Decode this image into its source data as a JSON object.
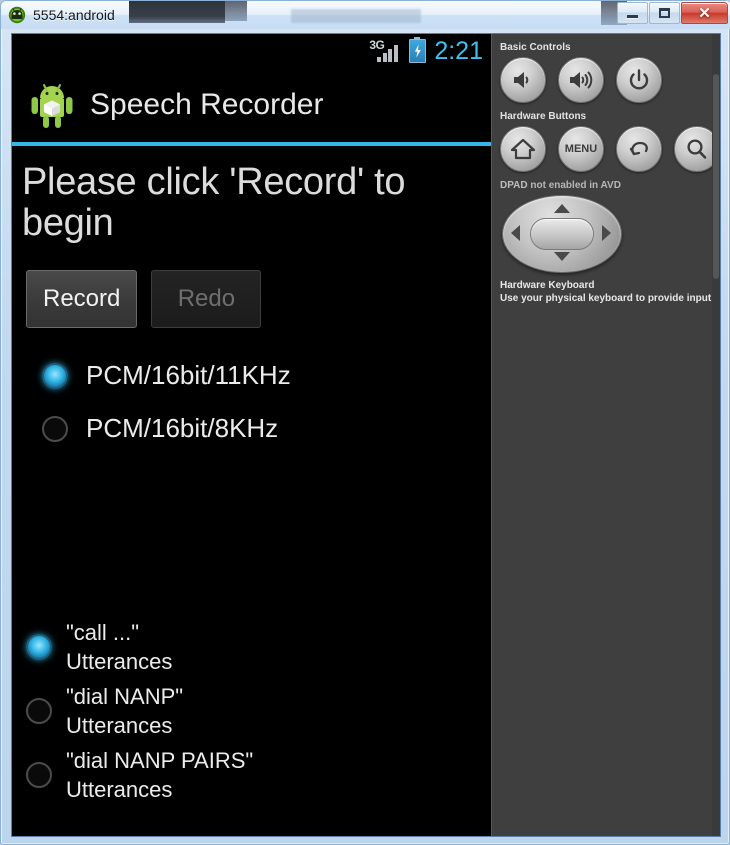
{
  "window": {
    "title": "5554:android",
    "icon": "android-head-icon",
    "buttons": {
      "minimize": "minimize-button",
      "maximize": "maximize-button",
      "close_label": "✕"
    }
  },
  "device": {
    "status_bar": {
      "network_type": "3G",
      "signal_bars": 4,
      "battery_state": "charging",
      "clock": "2:21",
      "clock_color": "#3fc0ef"
    },
    "app_bar": {
      "icon": "android-robot-icon",
      "title": "Speech Recorder",
      "accent_color": "#36b5e8"
    },
    "content": {
      "headline": "Please click 'Record' to begin",
      "buttons": [
        {
          "label": "Record",
          "enabled": true
        },
        {
          "label": "Redo",
          "enabled": false
        }
      ],
      "format_options": [
        {
          "label": "PCM/16bit/11KHz",
          "selected": true
        },
        {
          "label": "PCM/16bit/8KHz",
          "selected": false
        }
      ],
      "utterance_options": [
        {
          "label": "\"call ...\"\nUtterances",
          "selected": true
        },
        {
          "label": "\"dial NANP\"\nUtterances",
          "selected": false
        },
        {
          "label": "\"dial NANP PAIRS\"\nUtterances",
          "selected": false
        }
      ]
    }
  },
  "panel": {
    "basic_controls_label": "Basic Controls",
    "basic_controls": [
      {
        "name": "volume-down-button",
        "icon": "speaker-low-icon"
      },
      {
        "name": "volume-up-button",
        "icon": "speaker-high-icon"
      },
      {
        "name": "power-button",
        "icon": "power-icon"
      }
    ],
    "hardware_buttons_label": "Hardware Buttons",
    "hardware_buttons": [
      {
        "name": "home-button",
        "icon": "home-icon",
        "label": ""
      },
      {
        "name": "menu-button",
        "icon": "menu-text-icon",
        "label": "MENU"
      },
      {
        "name": "back-button",
        "icon": "back-arrow-icon",
        "label": ""
      },
      {
        "name": "search-button",
        "icon": "search-icon",
        "label": ""
      }
    ],
    "dpad_label_strong": "DPAD",
    "dpad_label_rest": " not enabled in AVD",
    "keyboard_title": "Hardware Keyboard",
    "keyboard_hint": "Use your physical keyboard to provide input"
  }
}
